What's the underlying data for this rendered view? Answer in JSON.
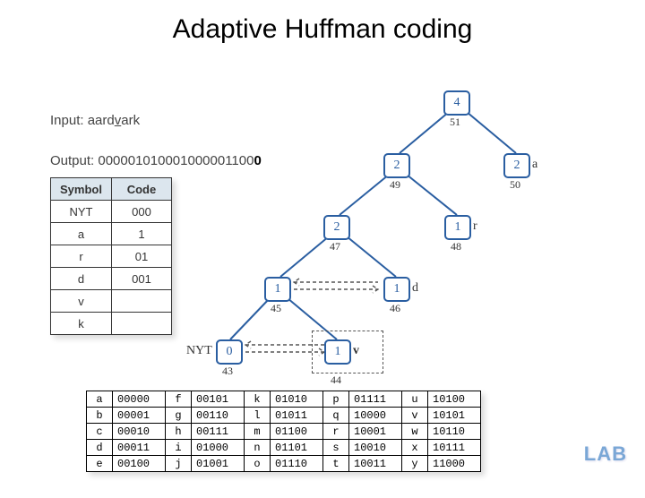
{
  "title": "Adaptive Huffman coding",
  "input": {
    "label": "Input:",
    "value": "aardvark",
    "underline_char": "v"
  },
  "output": {
    "label": "Output:",
    "value_prefix": "000001010001000001100",
    "value_bold": "0"
  },
  "symbol_table": {
    "headers": [
      "Symbol",
      "Code"
    ],
    "rows": [
      {
        "symbol": "NYT",
        "code": "000"
      },
      {
        "symbol": "a",
        "code": "1"
      },
      {
        "symbol": "r",
        "code": "01"
      },
      {
        "symbol": "d",
        "code": "001"
      },
      {
        "symbol": "v",
        "code": ""
      },
      {
        "symbol": "k",
        "code": ""
      }
    ]
  },
  "tree": {
    "nodes": {
      "n51": {
        "weight": "4",
        "order": "51"
      },
      "n50": {
        "weight": "2",
        "order": "50",
        "sym": "a"
      },
      "n49": {
        "weight": "2",
        "order": "49"
      },
      "n48": {
        "weight": "1",
        "order": "48",
        "sym": "r"
      },
      "n47": {
        "weight": "2",
        "order": "47"
      },
      "n46": {
        "weight": "1",
        "order": "46",
        "sym": "d"
      },
      "n45": {
        "weight": "1",
        "order": "45"
      },
      "n44": {
        "weight": "1",
        "order": "44",
        "sym": "v"
      },
      "n43": {
        "weight": "0",
        "order": "43",
        "sym": "NYT"
      }
    }
  },
  "alpha_table": {
    "cols": [
      [
        [
          "a",
          "00000"
        ],
        [
          "b",
          "00001"
        ],
        [
          "c",
          "00010"
        ],
        [
          "d",
          "00011"
        ],
        [
          "e",
          "00100"
        ]
      ],
      [
        [
          "f",
          "00101"
        ],
        [
          "g",
          "00110"
        ],
        [
          "h",
          "00111"
        ],
        [
          "i",
          "01000"
        ],
        [
          "j",
          "01001"
        ]
      ],
      [
        [
          "k",
          "01010"
        ],
        [
          "l",
          "01011"
        ],
        [
          "m",
          "01100"
        ],
        [
          "n",
          "01101"
        ],
        [
          "o",
          "01110"
        ]
      ],
      [
        [
          "p",
          "01111"
        ],
        [
          "q",
          "10000"
        ],
        [
          "r",
          "10001"
        ],
        [
          "s",
          "10010"
        ],
        [
          "t",
          "10011"
        ]
      ],
      [
        [
          "u",
          "10100"
        ],
        [
          "v",
          "10101"
        ],
        [
          "w",
          "10110"
        ],
        [
          "x",
          "10111"
        ],
        [
          "y",
          "11000"
        ]
      ]
    ]
  },
  "lab_stamp": "LAB"
}
